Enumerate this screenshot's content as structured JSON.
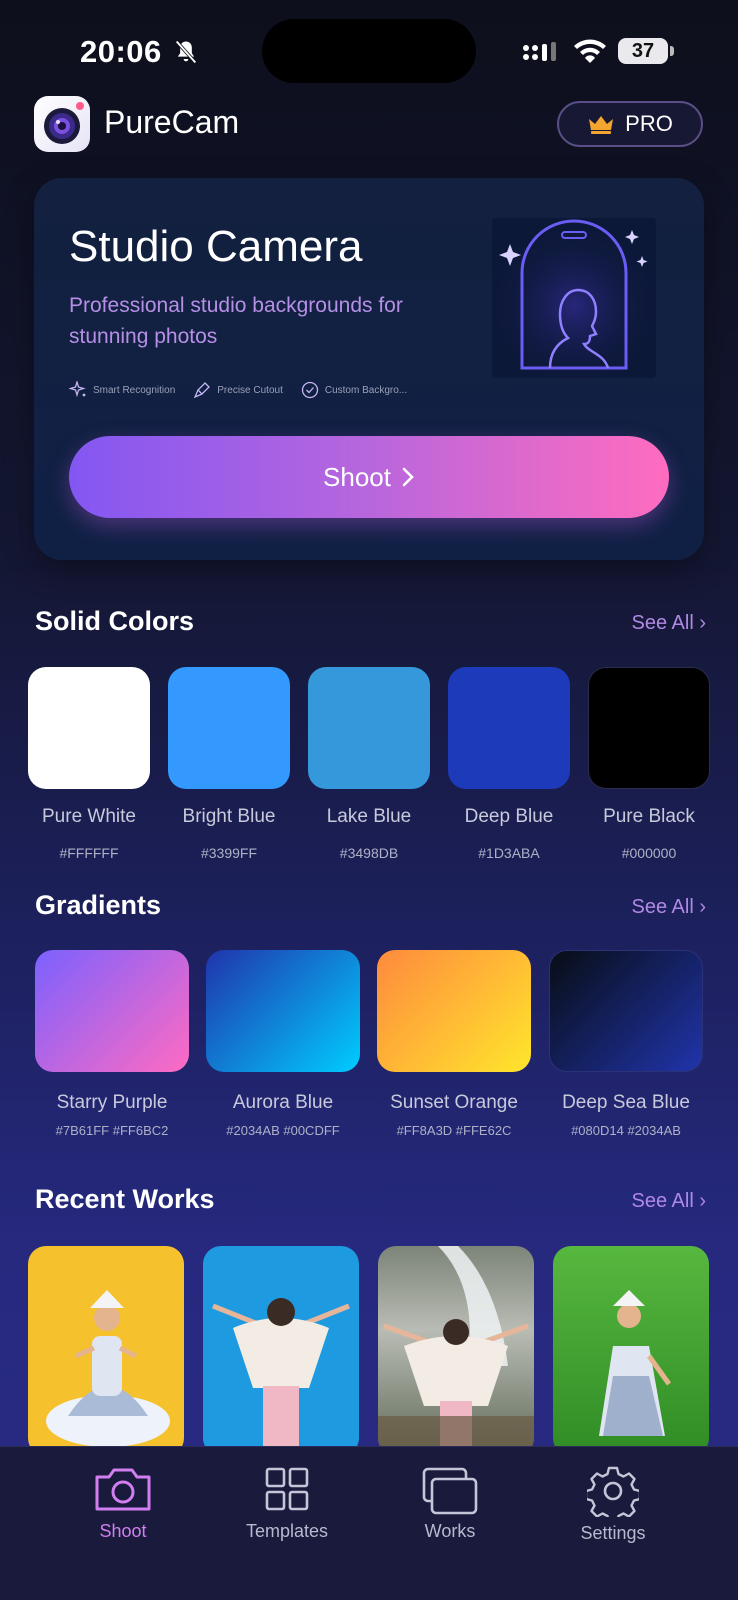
{
  "status_bar": {
    "time": "20:06",
    "battery": "37"
  },
  "header": {
    "app_name": "PureCam",
    "pro_label": "PRO"
  },
  "hero": {
    "title": "Studio Camera",
    "subtitle": "Professional studio backgrounds for stunning photos",
    "features": [
      "Smart Recognition",
      "Precise Cutout",
      "Custom Backgro..."
    ],
    "button": "Shoot"
  },
  "solid_colors": {
    "title": "Solid Colors",
    "see_all": "See All",
    "items": [
      {
        "name": "Pure White",
        "hex": "#FFFFFF",
        "color": "#FFFFFF"
      },
      {
        "name": "Bright Blue",
        "hex": "#3399FF",
        "color": "#3399FF"
      },
      {
        "name": "Lake Blue",
        "hex": "#3498DB",
        "color": "#3498DB"
      },
      {
        "name": "Deep Blue",
        "hex": "#1D3ABA",
        "color": "#1D3ABA"
      },
      {
        "name": "Pure Black",
        "hex": "#000000",
        "color": "#000000"
      }
    ]
  },
  "gradients": {
    "title": "Gradients",
    "see_all": "See All",
    "items": [
      {
        "name": "Starry Purple",
        "hex": "#7B61FF #FF6BC2",
        "from": "#7B61FF",
        "to": "#FF6BC2"
      },
      {
        "name": "Aurora Blue",
        "hex": "#2034AB #00CDFF",
        "from": "#2034AB",
        "to": "#00CDFF"
      },
      {
        "name": "Sunset Orange",
        "hex": "#FF8A3D #FFE62C",
        "from": "#FF8A3D",
        "to": "#FFE62C"
      },
      {
        "name": "Deep Sea Blue",
        "hex": "#080D14 #2034AB",
        "from": "#080D14",
        "to": "#2034AB"
      }
    ]
  },
  "recent_works": {
    "title": "Recent Works",
    "see_all": "See All",
    "items": [
      {
        "background": "#F5C22E"
      },
      {
        "background": "#1E9BE0"
      },
      {
        "background": "#8a8f8a"
      },
      {
        "background": "#3fa02f"
      }
    ]
  },
  "tabbar": {
    "active": "Shoot",
    "items": [
      {
        "label": "Shoot",
        "icon": "camera-icon"
      },
      {
        "label": "Templates",
        "icon": "grid-icon"
      },
      {
        "label": "Works",
        "icon": "stack-icon"
      },
      {
        "label": "Settings",
        "icon": "gear-icon"
      }
    ]
  },
  "colors": {
    "accent": "#B189E4",
    "button_from": "#8457F2",
    "button_to": "#FF6CBF"
  }
}
